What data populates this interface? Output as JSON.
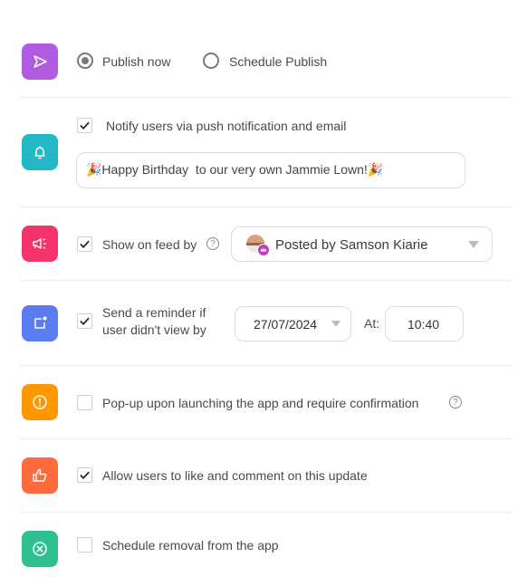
{
  "publish": {
    "icon": "send-icon",
    "color": "#b15be0",
    "options": [
      {
        "label": "Publish now",
        "selected": true
      },
      {
        "label": "Schedule Publish",
        "selected": false
      }
    ]
  },
  "notify": {
    "icon": "bell-icon",
    "color": "#22b8c8",
    "checked": true,
    "label": "Notify users via push notification and email",
    "message": "🎉Happy Birthday  to our very own Jammie Lown!🎉"
  },
  "feed": {
    "icon": "megaphone-icon",
    "color": "#f5336b",
    "checked": true,
    "label": "Show on feed by",
    "help": "?",
    "poster": "Posted by Samson Kiarie"
  },
  "reminder": {
    "icon": "notification-dot-icon",
    "color": "#5b7cf0",
    "checked": true,
    "label_line1": "Send a reminder if",
    "label_line2": "user didn't view by",
    "date": "27/07/2024",
    "at_label": "At:",
    "time": "10:40"
  },
  "popup": {
    "icon": "alert-circle-icon",
    "color": "#ff9800",
    "checked": false,
    "label": "Pop-up upon launching the app and require confirmation",
    "help": "?"
  },
  "likes": {
    "icon": "thumbs-up-icon",
    "color": "#ff6b3d",
    "checked": true,
    "label": "Allow users to like and comment on this update"
  },
  "removal": {
    "icon": "close-circle-icon",
    "color": "#2fc08f",
    "checked": false,
    "label": "Schedule removal from the app"
  }
}
